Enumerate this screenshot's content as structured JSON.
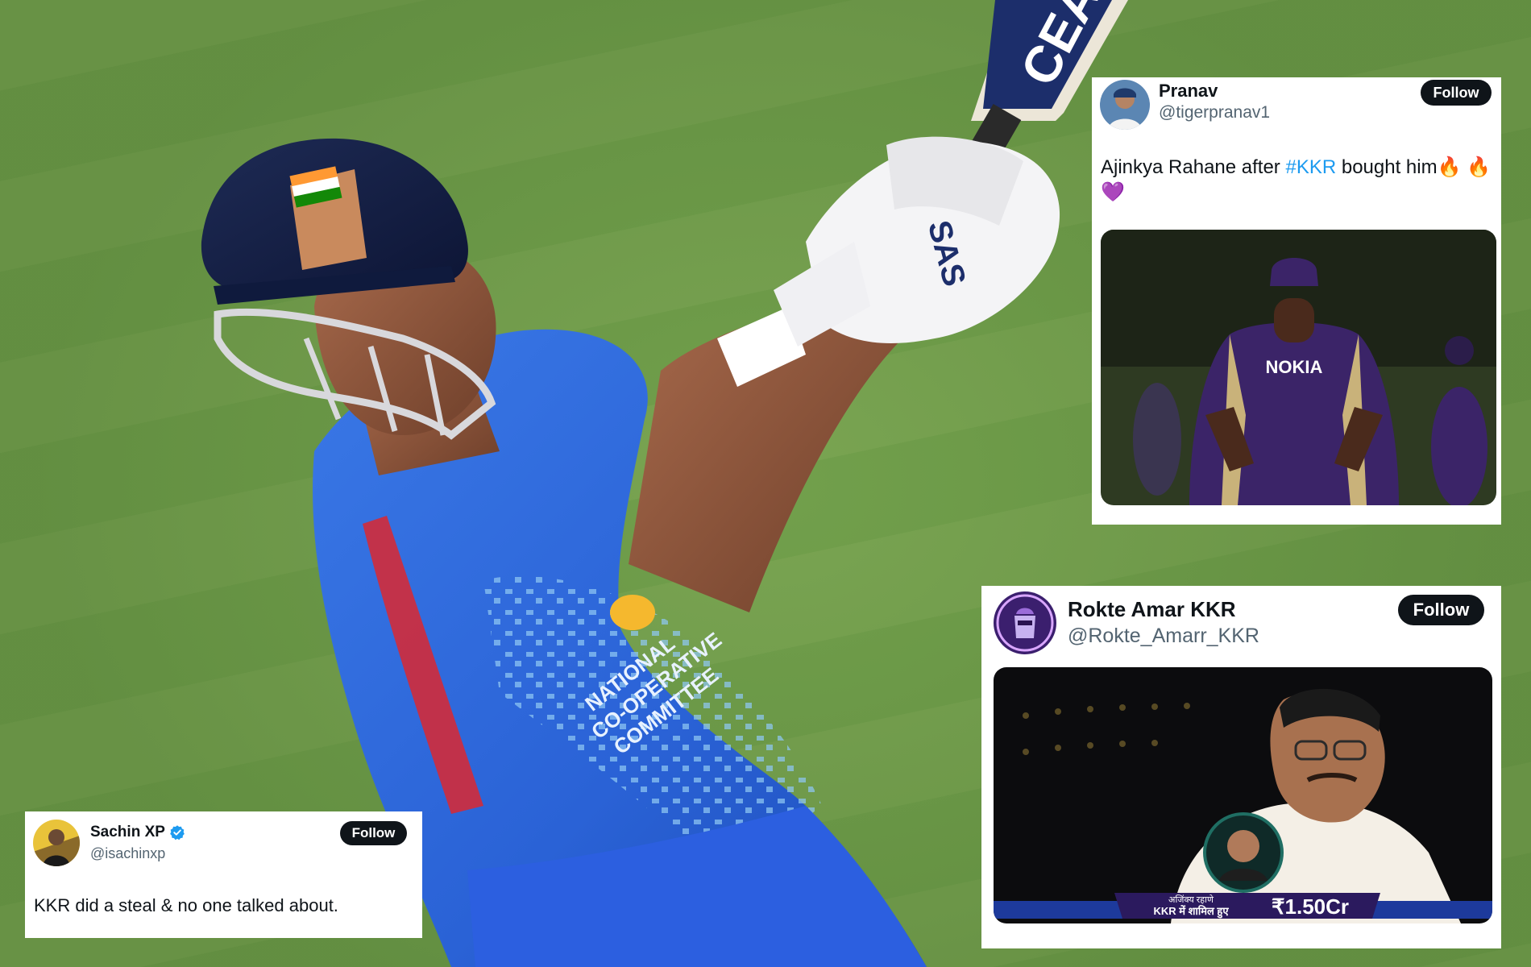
{
  "tweets": [
    {
      "name": "Pranav",
      "handle": "@tigerpranav1",
      "follow_label": "Follow",
      "text_before": "Ajinkya Rahane after ",
      "hashtag": "#KKR",
      "text_after": " bought him🔥 🔥",
      "text_line2": "💜",
      "media": {
        "jersey_text": "NOKIA"
      }
    },
    {
      "name": "Rokte Amar KKR",
      "handle": "@Rokte_Amarr_KKR",
      "follow_label": "Follow",
      "media": {
        "ticker_line1": "अजिंक्य रहाणे",
        "ticker_line2": "KKR में शामिल हुए",
        "ticker_price": "₹1.50Cr"
      }
    },
    {
      "name": "Sachin XP",
      "handle": "@isachinxp",
      "follow_label": "Follow",
      "text": "KKR did a steal & no one talked about.",
      "verified": true
    }
  ],
  "background": {
    "bat_text": "CEAT",
    "glove_text": "SAS",
    "shirt_text_1": "NATIONAL",
    "shirt_text_2": "CO-OPERATIVE",
    "shirt_text_3": "COMMITTEE"
  },
  "colors": {
    "follow_bg": "#0f1419",
    "hashtag": "#1d9bf0",
    "handle": "#536471",
    "jersey_blue": "#2a62d6",
    "kkr_purple": "#3b2468",
    "field_green": "#7aa552"
  }
}
